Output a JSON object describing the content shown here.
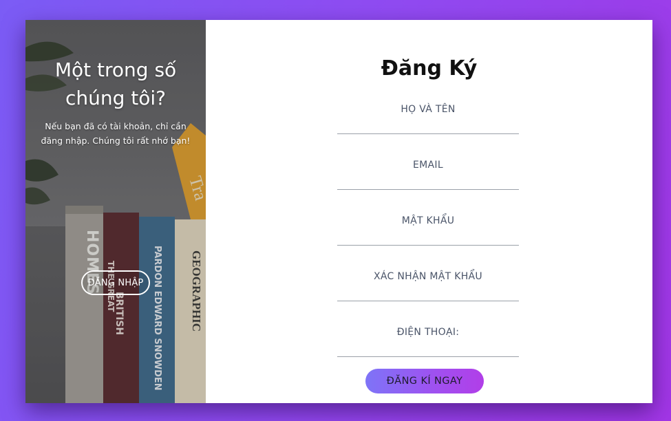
{
  "side": {
    "title_line1": "Một trong số",
    "title_line2": "chúng tôi?",
    "text_line1": "Nếu bạn đã có tài khoản, chỉ cần",
    "text_line2": "đăng nhập. Chúng tôi rất nhớ bạn!",
    "login_label": "ĐĂNG NHẬP",
    "book_spines": [
      "HOMES",
      "BRITISH",
      "THE GREAT",
      "PARDON EDWARD SNOWDEN",
      "GEOGRAPHIC",
      "Tra"
    ]
  },
  "form": {
    "title": "Đăng Ký",
    "fields": [
      {
        "label": "HỌ VÀ TÊN",
        "value": ""
      },
      {
        "label": "EMAIL",
        "value": ""
      },
      {
        "label": "MẬT KHẨU",
        "value": ""
      },
      {
        "label": "XÁC NHẬN MẬT KHẨU",
        "value": ""
      },
      {
        "label": "ĐIỆN THOẠI:",
        "value": ""
      }
    ],
    "submit_label": "ĐĂNG KÍ NGAY"
  },
  "colors": {
    "background_start": "#7b5cf5",
    "background_end": "#a236e6",
    "button_start": "#7e74f7",
    "button_end": "#b13ee8",
    "label": "#4a5468"
  }
}
